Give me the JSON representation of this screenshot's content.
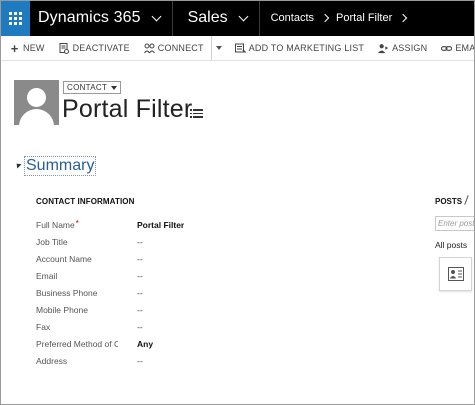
{
  "topnav": {
    "app_name": "Dynamics 365",
    "area": "Sales",
    "breadcrumbs": [
      "Contacts",
      "Portal Filter"
    ]
  },
  "commands": [
    {
      "label": "NEW",
      "icon": "plus-icon"
    },
    {
      "label": "DEACTIVATE",
      "icon": "deactivate-icon"
    },
    {
      "label": "CONNECT",
      "icon": "connect-icon"
    },
    {
      "label": "ADD TO MARKETING LIST",
      "icon": "marketing-list-icon"
    },
    {
      "label": "ASSIGN",
      "icon": "assign-icon"
    },
    {
      "label": "EMAIL A LINK",
      "icon": "link-icon"
    }
  ],
  "header": {
    "entity": "CONTACT",
    "title": "Portal Filter"
  },
  "summary": {
    "title": "Summary",
    "section_title": "CONTACT INFORMATION",
    "fields": [
      {
        "label": "Full Name",
        "value": "Portal Filter",
        "required": true,
        "bold": true
      },
      {
        "label": "Job Title",
        "value": "--"
      },
      {
        "label": "Account Name",
        "value": "--"
      },
      {
        "label": "Email",
        "value": "--"
      },
      {
        "label": "Business Phone",
        "value": "--"
      },
      {
        "label": "Mobile Phone",
        "value": "--"
      },
      {
        "label": "Fax",
        "value": "--"
      },
      {
        "label": "Preferred Method of Contact",
        "value": "Any",
        "bold": true
      },
      {
        "label": "Address",
        "value": "--"
      }
    ]
  },
  "posts": {
    "title": "POSTS",
    "input_placeholder": "Enter post here",
    "all_posts": "All posts"
  },
  "colors": {
    "nav_bg": "#000000",
    "waffle_bg": "#1e7bc0",
    "summary_link": "#2a5e94",
    "required": "#cc0000"
  }
}
